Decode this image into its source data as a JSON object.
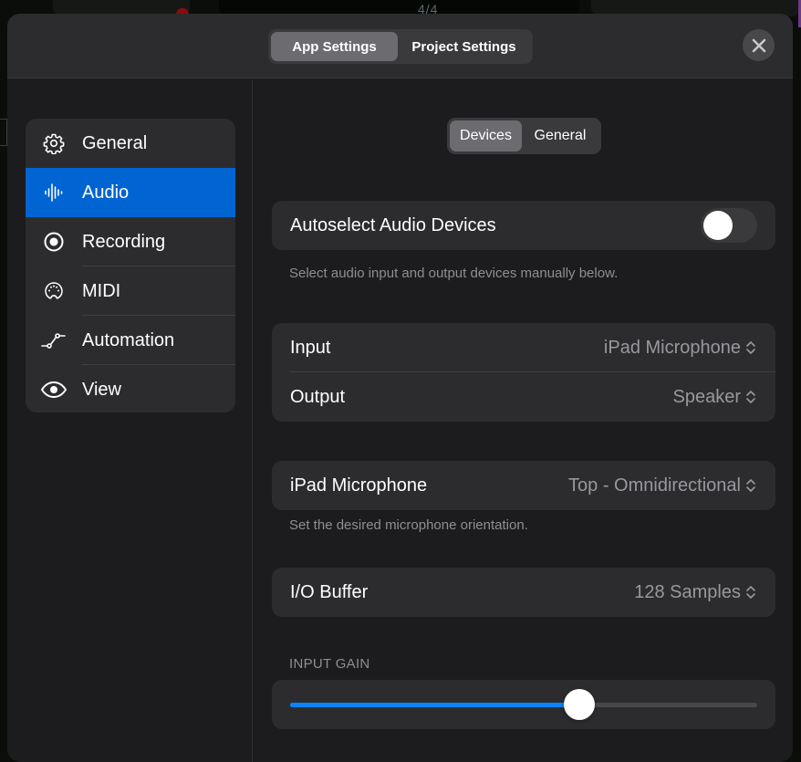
{
  "background_app": {
    "time_signature": "4/4"
  },
  "header": {
    "tabs": [
      {
        "label": "App Settings",
        "active": true
      },
      {
        "label": "Project Settings",
        "active": false
      }
    ],
    "close_icon": "close-icon"
  },
  "sidebar": {
    "items": [
      {
        "label": "General",
        "icon": "gear-icon",
        "active": false
      },
      {
        "label": "Audio",
        "icon": "waveform-icon",
        "active": true
      },
      {
        "label": "Recording",
        "icon": "record-icon",
        "active": false
      },
      {
        "label": "MIDI",
        "icon": "midi-connector-icon",
        "active": false
      },
      {
        "label": "Automation",
        "icon": "automation-curve-icon",
        "active": false
      },
      {
        "label": "View",
        "icon": "eye-icon",
        "active": false
      }
    ],
    "accent_color": "#0064d2"
  },
  "main": {
    "subtabs": [
      {
        "label": "Devices",
        "active": true
      },
      {
        "label": "General",
        "active": false
      }
    ],
    "autoselect": {
      "label": "Autoselect Audio Devices",
      "enabled": false,
      "note": "Select audio input and output devices manually below."
    },
    "io_devices": [
      {
        "label": "Input",
        "value": "iPad Microphone"
      },
      {
        "label": "Output",
        "value": "Speaker"
      }
    ],
    "microphone": {
      "label": "iPad Microphone",
      "value": "Top - Omnidirectional",
      "note": "Set the desired microphone orientation."
    },
    "buffer": {
      "label": "I/O Buffer",
      "value": "128 Samples"
    },
    "input_gain": {
      "caption": "INPUT GAIN",
      "value_fraction": 0.62,
      "fill_color": "#0a84ff"
    }
  }
}
